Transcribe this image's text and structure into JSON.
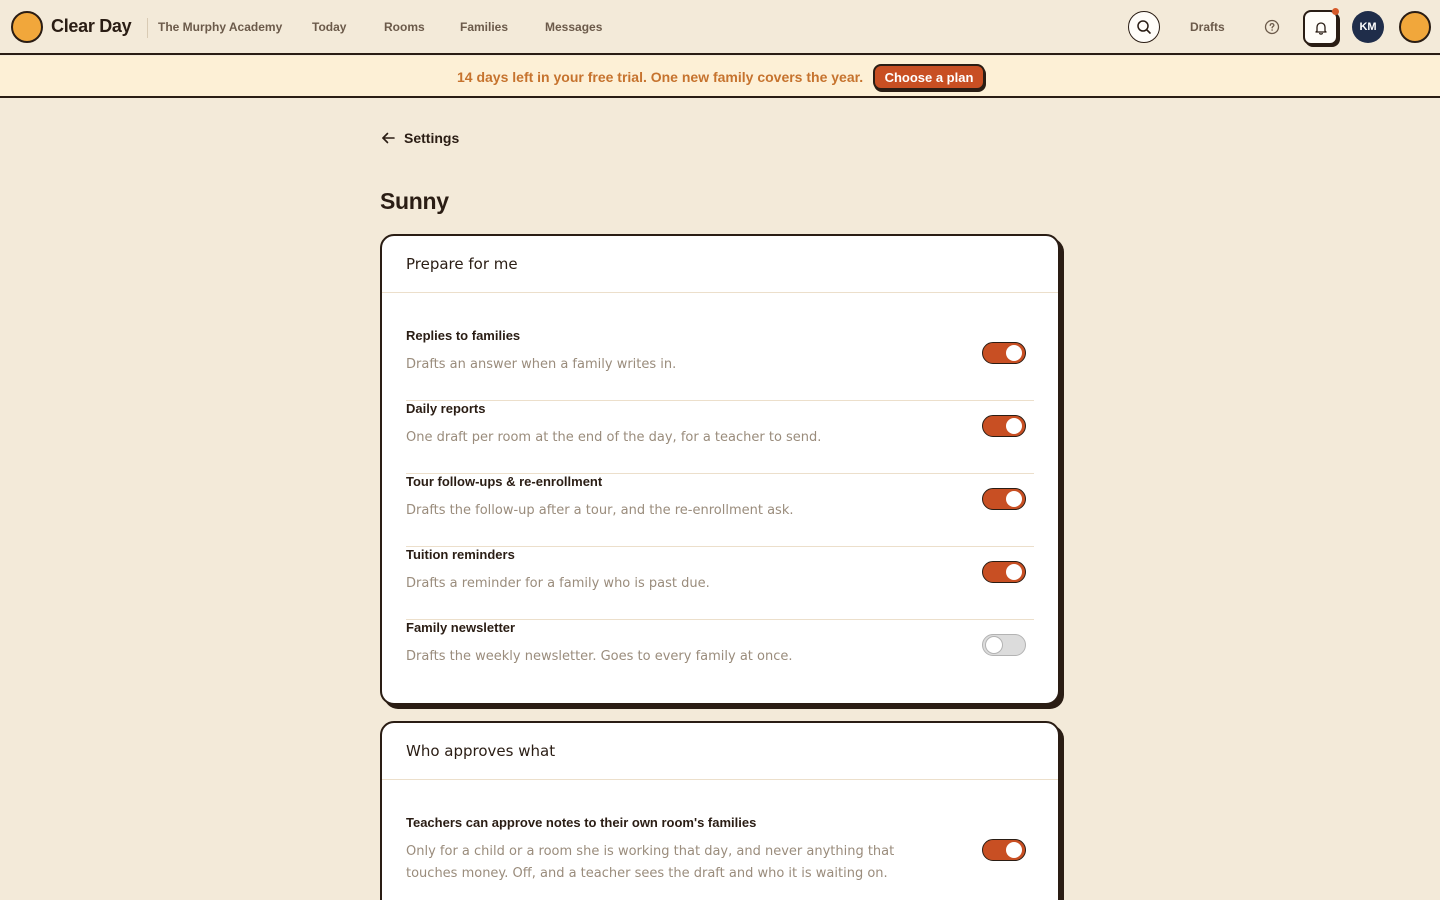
{
  "brand": {
    "name": "Clear Day"
  },
  "nav": {
    "school": "The Murphy Academy",
    "items": [
      "Today",
      "Rooms",
      "Families",
      "Messages"
    ],
    "drafts": "Drafts",
    "avatar_initials": "KM"
  },
  "banner": {
    "text": "14 days left in your free trial. One new family covers the year.",
    "button": "Choose a plan"
  },
  "page": {
    "back_label": "Settings",
    "title": "Sunny"
  },
  "sections": [
    {
      "title": "Prepare for me",
      "rows": [
        {
          "title": "Replies to families",
          "desc": "Drafts an answer when a family writes in.",
          "on": true
        },
        {
          "title": "Daily reports",
          "desc": "One draft per room at the end of the day, for a teacher to send.",
          "on": true
        },
        {
          "title": "Tour follow-ups & re-enrollment",
          "desc": "Drafts the follow-up after a tour, and the re-enrollment ask.",
          "on": true
        },
        {
          "title": "Tuition reminders",
          "desc": "Drafts a reminder for a family who is past due.",
          "on": true
        },
        {
          "title": "Family newsletter",
          "desc": "Drafts the weekly newsletter. Goes to every family at once.",
          "on": false
        }
      ]
    },
    {
      "title": "Who approves what",
      "rows": [
        {
          "title": "Teachers can approve notes to their own room's families",
          "desc": "Only for a child or a room she is working that day, and never anything that touches money. Off, and a teacher sees the draft and who it is waiting on.",
          "on": true
        }
      ]
    }
  ],
  "icons": {
    "search": "search-icon",
    "help": "help-circle-icon",
    "bell": "bell-icon",
    "back": "arrow-left-icon"
  },
  "colors": {
    "background": "#f3ead9",
    "accent": "#c84f23",
    "brand_sun": "#f1a73b",
    "ink": "#2a1d14",
    "banner_bg": "#fdf0d6",
    "banner_text": "#c6732e"
  }
}
